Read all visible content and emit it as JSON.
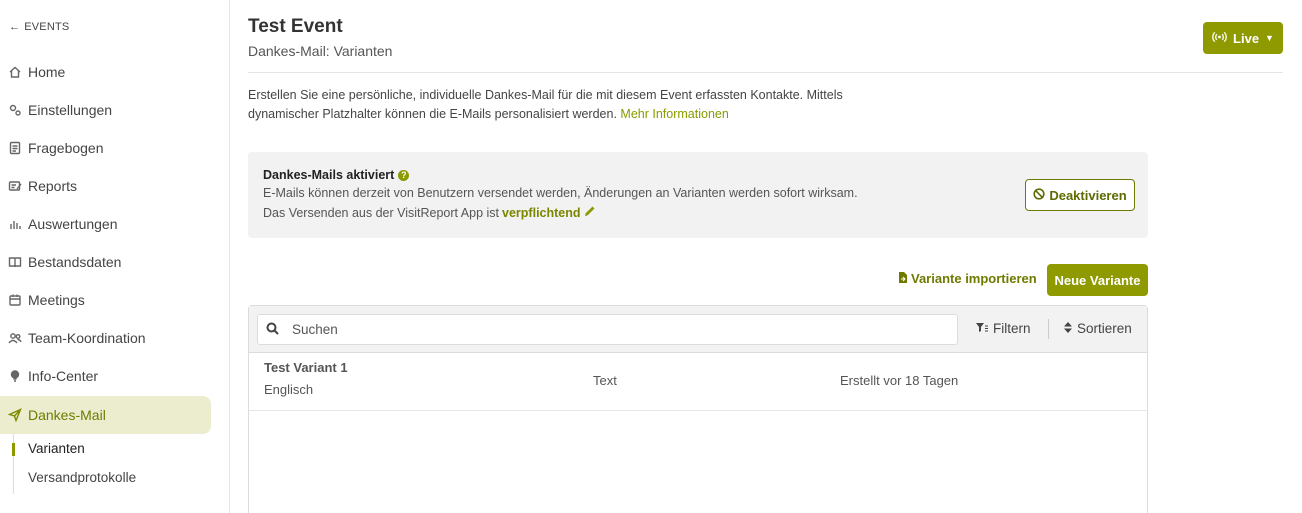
{
  "sidebar": {
    "back_label": "EVENTS",
    "items": [
      {
        "label": "Home",
        "icon": "home-icon"
      },
      {
        "label": "Einstellungen",
        "icon": "gears-icon"
      },
      {
        "label": "Fragebogen",
        "icon": "questionnaire-icon"
      },
      {
        "label": "Reports",
        "icon": "reports-icon"
      },
      {
        "label": "Auswertungen",
        "icon": "bar-chart-icon"
      },
      {
        "label": "Bestandsdaten",
        "icon": "book-icon"
      },
      {
        "label": "Meetings",
        "icon": "calendar-icon"
      },
      {
        "label": "Team-Koordination",
        "icon": "team-icon"
      },
      {
        "label": "Info-Center",
        "icon": "lightbulb-icon"
      },
      {
        "label": "Dankes-Mail",
        "icon": "paper-plane-icon",
        "active": true
      }
    ],
    "subitems": [
      {
        "label": "Varianten",
        "active": true
      },
      {
        "label": "Versandprotokolle"
      }
    ]
  },
  "header": {
    "title": "Test Event",
    "subtitle": "Dankes-Mail: Varianten",
    "live_label": "Live"
  },
  "intro": {
    "text": "Erstellen Sie eine persönliche, individuelle Dankes-Mail für die mit diesem Event erfassten Kontakte. Mittels dynamischer Platzhalter können die E-Mails personalisiert werden.",
    "link": "Mehr Informationen"
  },
  "status": {
    "title": "Dankes-Mails aktiviert",
    "line1": "E-Mails können derzeit von Benutzern versendet werden, Änderungen an Varianten werden sofort wirksam.",
    "line2_prefix": "Das Versenden aus der VisitReport App ist",
    "line2_link": "verpflichtend",
    "deactivate_label": "Deaktivieren"
  },
  "actions": {
    "import_label": "Variante importieren",
    "new_label": "Neue Variante"
  },
  "table": {
    "search_placeholder": "Suchen",
    "filter_label": "Filtern",
    "sort_label": "Sortieren",
    "rows": [
      {
        "name": "Test Variant 1",
        "language": "Englisch",
        "type": "Text",
        "created": "Erstellt vor 18 Tagen"
      }
    ]
  },
  "colors": {
    "accent": "#8e9a00",
    "active_bg": "#ecedcf"
  }
}
